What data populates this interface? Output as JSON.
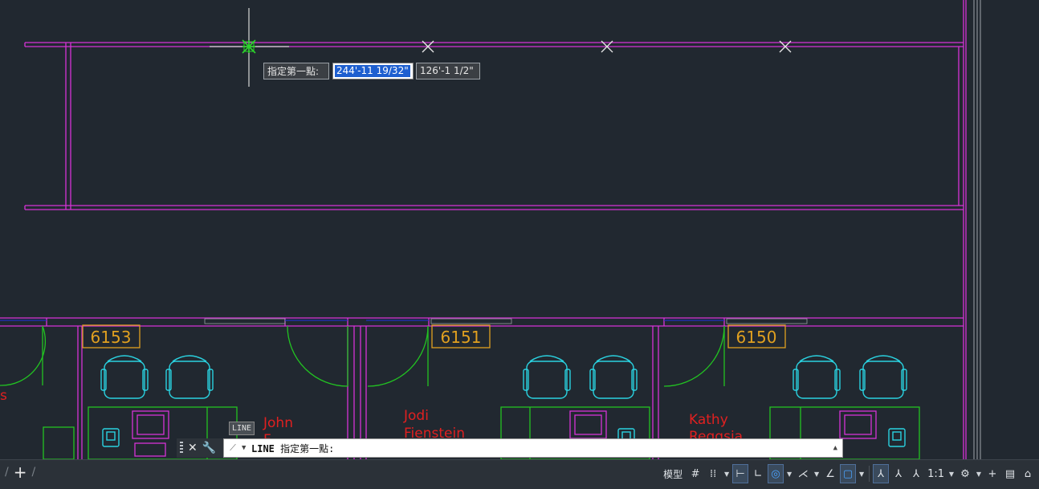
{
  "drawing": {
    "rooms": [
      {
        "number": "6153",
        "occupant_line1": "John",
        "occupant_line2": "F"
      },
      {
        "number": "6151",
        "occupant_line1": "Jodi",
        "occupant_line2": "Fienstein"
      },
      {
        "number": "6150",
        "occupant_line1": "Kathy",
        "occupant_line2": "Reggsia"
      }
    ],
    "edge_fragment": "s",
    "colors": {
      "background": "#212830",
      "walls": "#d633d6",
      "doors": "#22c322",
      "room_tags": "#e0a020",
      "chairs": "#2ad2e0",
      "names": "#e02020",
      "blue_line": "#2030c0"
    }
  },
  "dynamic_input": {
    "prompt": "指定第一點:",
    "x_value": "244'-11 19/32\"",
    "y_value": "126'-1 1/2\""
  },
  "tooltip": "LINE",
  "command_line": {
    "command": "LINE",
    "prompt": "指定第一點:"
  },
  "status_bar": {
    "model_label": "模型",
    "scale_label": "1:1"
  }
}
